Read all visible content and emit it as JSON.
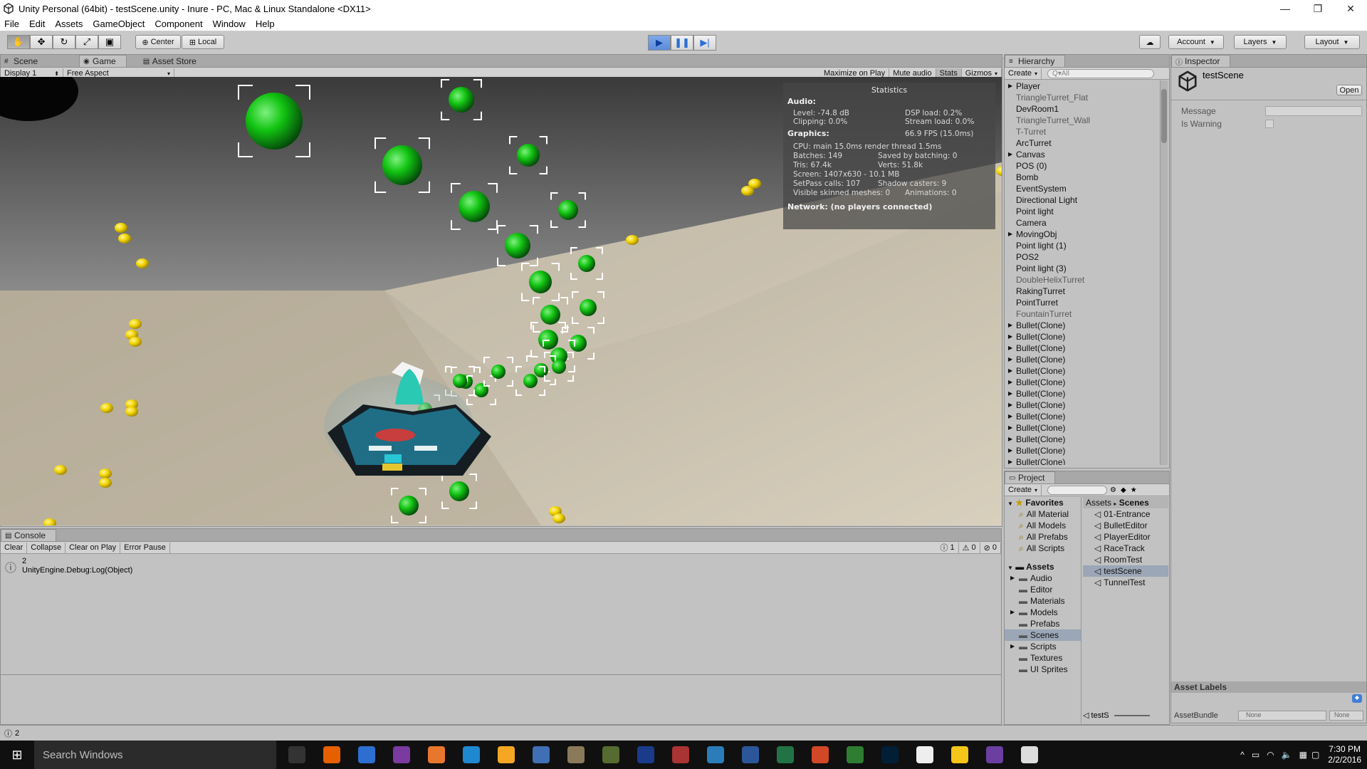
{
  "window": {
    "title": "Unity Personal (64bit) - testScene.unity - Inure - PC, Mac & Linux Standalone <DX11>",
    "controls": [
      "—",
      "❐",
      "✕"
    ]
  },
  "menubar": [
    "File",
    "Edit",
    "Assets",
    "GameObject",
    "Component",
    "Window",
    "Help"
  ],
  "toolbar": {
    "tools": [
      "hand-icon",
      "move-icon",
      "rotate-icon",
      "scale-icon",
      "rect-icon"
    ],
    "pivot": "Center",
    "space": "Local",
    "account": "Account",
    "layers": "Layers",
    "layout": "Layout"
  },
  "scene_tabs": {
    "tabs": [
      "Scene",
      "Game",
      "Asset Store"
    ],
    "active": "Game",
    "display": "Display 1",
    "aspect": "Free Aspect",
    "options": [
      "Maximize on Play",
      "Mute audio",
      "Stats",
      "Gizmos"
    ]
  },
  "stats": {
    "title": "Statistics",
    "audio_header": "Audio:",
    "level": "Level: -74.8 dB",
    "clipping": "Clipping: 0.0%",
    "dsp": "DSP load: 0.2%",
    "stream": "Stream load: 0.0%",
    "graphics_header": "Graphics:",
    "fps": "66.9 FPS (15.0ms)",
    "cpu": "CPU: main 15.0ms  render thread 1.5ms",
    "batches": "Batches: 149",
    "saved": "Saved by batching: 0",
    "tris": "Tris: 67.4k",
    "verts": "Verts: 51.8k",
    "screen": "Screen: 1407x630 - 10.1 MB",
    "setpass": "SetPass calls: 107",
    "shadow": "Shadow casters: 9",
    "skinned": "Visible skinned meshes: 0",
    "animations": "Animations: 0",
    "network": "Network: (no players connected)"
  },
  "hierarchy": {
    "title": "Hierarchy",
    "create": "Create",
    "search_placeholder": "Q▾All",
    "items": [
      {
        "label": "Player",
        "arrow": "▶",
        "dim": false
      },
      {
        "label": "TriangleTurret_Flat",
        "arrow": "",
        "dim": true
      },
      {
        "label": "DevRoom1",
        "arrow": "",
        "dim": false
      },
      {
        "label": "TriangleTurret_Wall",
        "arrow": "",
        "dim": true
      },
      {
        "label": "T-Turret",
        "arrow": "",
        "dim": true
      },
      {
        "label": "ArcTurret",
        "arrow": "",
        "dim": false
      },
      {
        "label": "Canvas",
        "arrow": "▶",
        "dim": false
      },
      {
        "label": "POS (0)",
        "arrow": "",
        "dim": false
      },
      {
        "label": "Bomb",
        "arrow": "",
        "dim": false
      },
      {
        "label": "EventSystem",
        "arrow": "",
        "dim": false
      },
      {
        "label": "Directional Light",
        "arrow": "",
        "dim": false
      },
      {
        "label": "Point light",
        "arrow": "",
        "dim": false
      },
      {
        "label": "Camera",
        "arrow": "",
        "dim": false
      },
      {
        "label": "MovingObj",
        "arrow": "▶",
        "dim": false
      },
      {
        "label": "Point light (1)",
        "arrow": "",
        "dim": false
      },
      {
        "label": "POS2",
        "arrow": "",
        "dim": false
      },
      {
        "label": "Point light (3)",
        "arrow": "",
        "dim": false
      },
      {
        "label": "DoubleHelixTurret",
        "arrow": "",
        "dim": true
      },
      {
        "label": "RakingTurret",
        "arrow": "",
        "dim": false
      },
      {
        "label": "PointTurret",
        "arrow": "",
        "dim": false
      },
      {
        "label": "FountainTurret",
        "arrow": "",
        "dim": true
      },
      {
        "label": "Bullet(Clone)",
        "arrow": "▶",
        "dim": false
      },
      {
        "label": "Bullet(Clone)",
        "arrow": "▶",
        "dim": false
      },
      {
        "label": "Bullet(Clone)",
        "arrow": "▶",
        "dim": false
      },
      {
        "label": "Bullet(Clone)",
        "arrow": "▶",
        "dim": false
      },
      {
        "label": "Bullet(Clone)",
        "arrow": "▶",
        "dim": false
      },
      {
        "label": "Bullet(Clone)",
        "arrow": "▶",
        "dim": false
      },
      {
        "label": "Bullet(Clone)",
        "arrow": "▶",
        "dim": false
      },
      {
        "label": "Bullet(Clone)",
        "arrow": "▶",
        "dim": false
      },
      {
        "label": "Bullet(Clone)",
        "arrow": "▶",
        "dim": false
      },
      {
        "label": "Bullet(Clone)",
        "arrow": "▶",
        "dim": false
      },
      {
        "label": "Bullet(Clone)",
        "arrow": "▶",
        "dim": false
      },
      {
        "label": "Bullet(Clone)",
        "arrow": "▶",
        "dim": false
      },
      {
        "label": "Bullet(Clone)",
        "arrow": "▶",
        "dim": false
      }
    ]
  },
  "inspector": {
    "title": "Inspector",
    "object_name": "testScene",
    "open": "Open",
    "fields": [
      "Message",
      "Is Warning"
    ],
    "asset_labels": "Asset Labels",
    "asset_bundle": "AssetBundle",
    "bundle_value": "None",
    "variant_value": "None"
  },
  "project": {
    "title": "Project",
    "create": "Create",
    "favorites": {
      "label": "Favorites",
      "items": [
        "All Material",
        "All Models",
        "All Prefabs",
        "All Scripts"
      ]
    },
    "assets": {
      "label": "Assets",
      "items": [
        {
          "label": "Audio",
          "arrow": "▶"
        },
        {
          "label": "Editor",
          "arrow": ""
        },
        {
          "label": "Materials",
          "arrow": ""
        },
        {
          "label": "Models",
          "arrow": "▶"
        },
        {
          "label": "Prefabs",
          "arrow": ""
        },
        {
          "label": "Scenes",
          "arrow": "",
          "selected": true
        },
        {
          "label": "Scripts",
          "arrow": "▶"
        },
        {
          "label": "Textures",
          "arrow": ""
        },
        {
          "label": "UI Sprites",
          "arrow": ""
        }
      ]
    },
    "breadcrumb": [
      "Assets",
      "Scenes"
    ],
    "scenes": [
      {
        "label": "01-Entrance",
        "selected": false
      },
      {
        "label": "BulletEditor",
        "selected": false
      },
      {
        "label": "PlayerEditor",
        "selected": false
      },
      {
        "label": "RaceTrack",
        "selected": false
      },
      {
        "label": "RoomTest",
        "selected": false
      },
      {
        "label": "testScene",
        "selected": true
      },
      {
        "label": "TunnelTest",
        "selected": false
      }
    ],
    "footer_label": "testS"
  },
  "console": {
    "title": "Console",
    "buttons": [
      "Clear",
      "Collapse",
      "Clear on Play",
      "Error Pause"
    ],
    "counts": [
      "1",
      "0",
      "0"
    ],
    "entry_line1": "2",
    "entry_line2": "UnityEngine.Debug:Log(Object)"
  },
  "statusbar": {
    "text": "2"
  },
  "taskbar": {
    "search": "Search Windows",
    "time": "7:30 PM",
    "date": "2/2/2016"
  },
  "colors": {
    "accent_blue": "#2b6fd6",
    "play_active": "#5b8ddb",
    "selection": "#9ba6b6",
    "bullet_green": "#1fbf1f",
    "coin_yellow": "#f2d400"
  }
}
